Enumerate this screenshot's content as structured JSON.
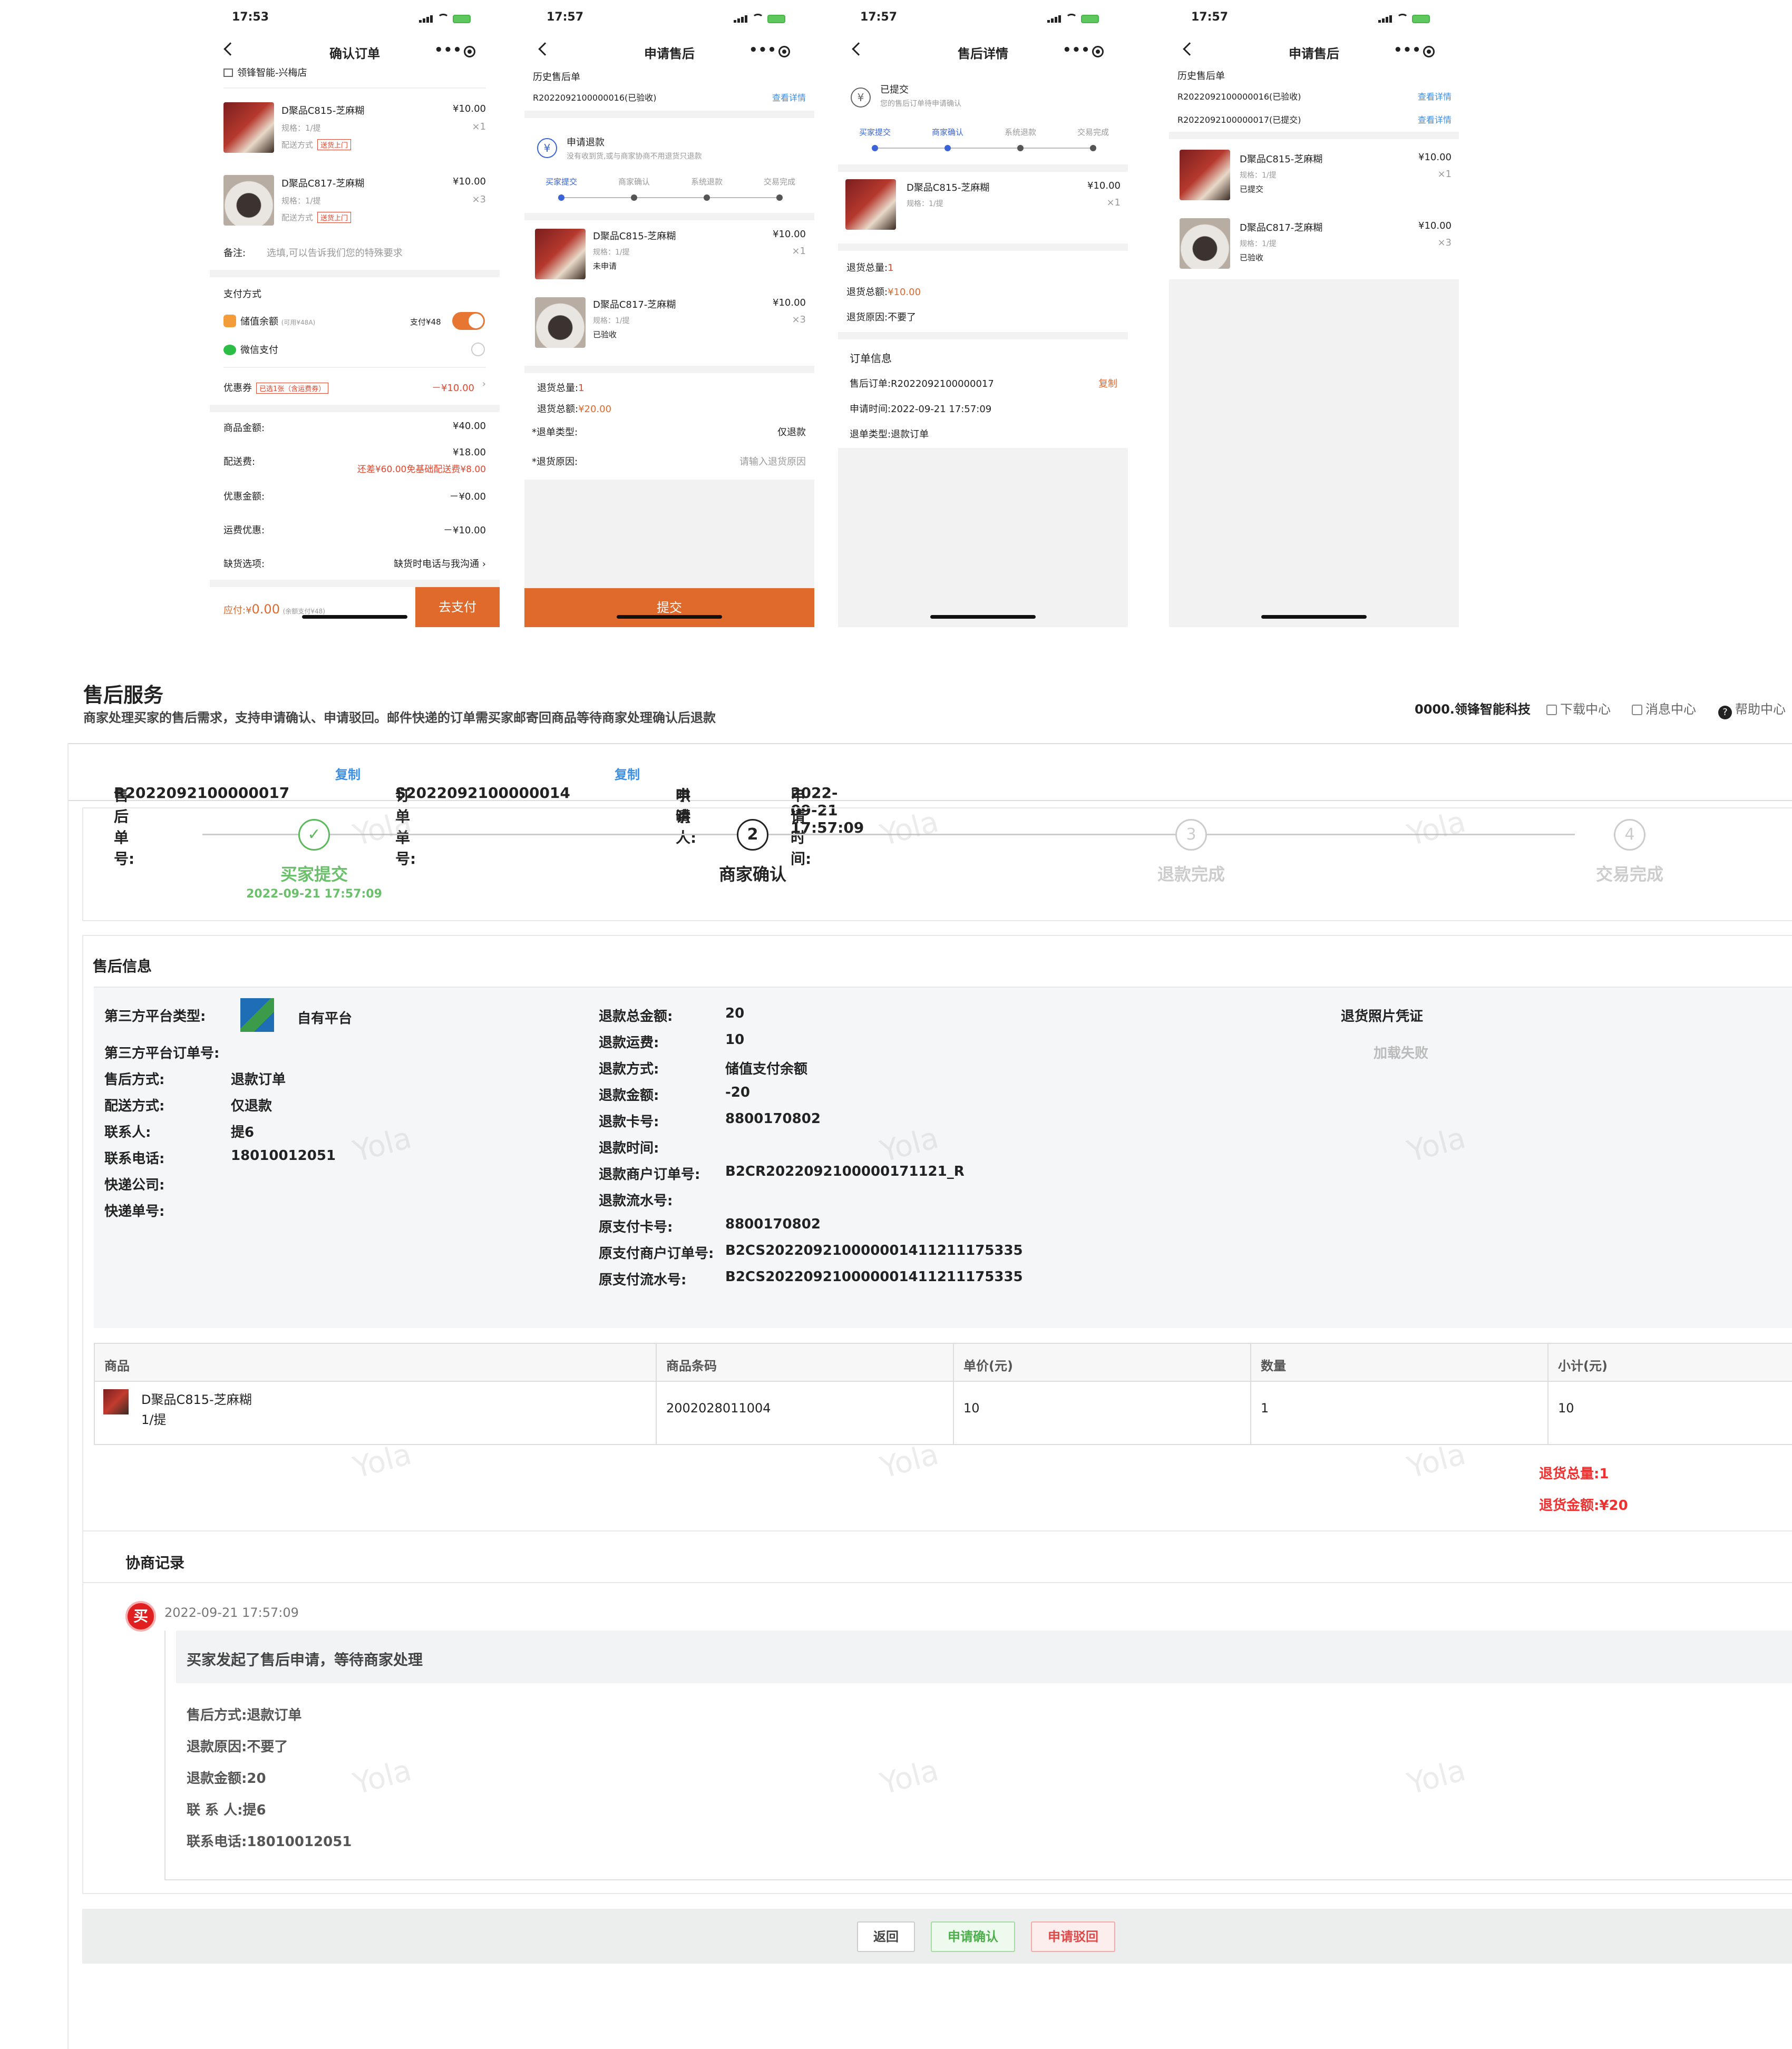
{
  "status_time_1": "17:53",
  "status_time_2": "17:57",
  "phone1": {
    "title": "确认订单",
    "store": "领锋智能-兴梅店",
    "items": [
      {
        "name": "D聚品C815-芝麻糊",
        "spec": "规格：1/提",
        "ship_label": "配送方式",
        "ship_tag": "送货上门",
        "price": "¥10.00",
        "qty": "×1"
      },
      {
        "name": "D聚品C817-芝麻糊",
        "spec": "规格：1/提",
        "ship_label": "配送方式",
        "ship_tag": "送货上门",
        "price": "¥10.00",
        "qty": "×3"
      }
    ],
    "remark_label": "备注:",
    "remark_placeholder": "选填,可以告诉我们您的特殊要求",
    "pay_method_title": "支付方式",
    "pay_balance": "储值余额",
    "pay_balance_avail": "(可用¥48A)",
    "pay_balance_amount": "支付¥48",
    "pay_wechat": "微信支付",
    "coupon_label": "优惠券",
    "coupon_tag": "已选1张（含运费券）",
    "coupon_amount": "－¥10.00",
    "goods_amount_label": "商品金额:",
    "goods_amount": "¥40.00",
    "delivery_label": "配送费:",
    "delivery_amount": "¥18.00",
    "delivery_note": "还差¥60.00免基础配送费¥8.00",
    "discount_label": "优惠金额:",
    "discount_amount": "－¥0.00",
    "freight_discount_label": "运费优惠:",
    "freight_discount_amount": "－¥10.00",
    "shortage_label": "缺货选项:",
    "shortage_value": "缺货时电话与我沟通",
    "payable_label": "应付:¥",
    "payable_amount": "0.00",
    "payable_note": "(余额支付¥48)",
    "pay_button": "去支付"
  },
  "phone2": {
    "title": "申请售后",
    "history_title": "历史售后单",
    "history_no": "R2022092100000016(已验收)",
    "history_link": "查看详情",
    "refund_title": "申请退款",
    "refund_sub": "没有收到货,或与商家协商不用退货只退款",
    "steps": [
      "买家提交",
      "商家确认",
      "系统退款",
      "交易完成"
    ],
    "items": [
      {
        "name": "D聚品C815-芝麻糊",
        "spec": "规格：1/提",
        "status": "未申请",
        "price": "¥10.00",
        "qty": "×1"
      },
      {
        "name": "D聚品C817-芝麻糊",
        "spec": "规格：1/提",
        "status": "已验收",
        "price": "¥10.00",
        "qty": "×3"
      }
    ],
    "total_qty_label": "退货总量:",
    "total_qty": "1",
    "total_amount_label": "退货总额:",
    "total_amount": "¥20.00",
    "type_label": "*退单类型:",
    "type_value": "仅退款",
    "reason_label": "*退货原因:",
    "reason_placeholder": "请输入退货原因",
    "submit": "提交"
  },
  "phone3": {
    "title": "售后详情",
    "status": "已提交",
    "status_sub": "您的售后订单待申请确认",
    "steps": [
      "买家提交",
      "商家确认",
      "系统退款",
      "交易完成"
    ],
    "item": {
      "name": "D聚品C815-芝麻糊",
      "spec": "规格：1/提",
      "price": "¥10.00",
      "qty": "×1"
    },
    "total_qty_label": "退货总量:",
    "total_qty": "1",
    "total_amount_label": "退货总额:",
    "total_amount": "¥10.00",
    "reason_label": "退货原因:",
    "reason": "不要了",
    "order_info_title": "订单信息",
    "order_no_label": "售后订单:",
    "order_no": "R2022092100000017",
    "copy": "复制",
    "apply_time_label": "申请时间:",
    "apply_time": "2022-09-21 17:57:09",
    "refund_type_label": "退单类型:",
    "refund_type": "退款订单"
  },
  "phone4": {
    "title": "申请售后",
    "history_title": "历史售后单",
    "history": [
      {
        "no": "R2022092100000016(已验收)",
        "link": "查看详情"
      },
      {
        "no": "R2022092100000017(已提交)",
        "link": "查看详情"
      }
    ],
    "items": [
      {
        "name": "D聚品C815-芝麻糊",
        "spec": "规格：1/提",
        "status": "已提交",
        "price": "¥10.00",
        "qty": "×1"
      },
      {
        "name": "D聚品C817-芝麻糊",
        "spec": "规格：1/提",
        "status": "已验收",
        "price": "¥10.00",
        "qty": "×3"
      }
    ]
  },
  "web": {
    "title": "售后服务",
    "subtitle": "商家处理买家的售后需求，支持申请确认、申请驳回。邮件快递的订单需买家邮寄回商品等待商家处理确认后退款",
    "company": "0000.领锋智能科技",
    "download": "下载中心",
    "messages": "消息中心",
    "help": "帮助中心",
    "after_no_label": "售后单号:",
    "after_no": "R2022092100000017",
    "order_no_label": "订单单号:",
    "order_no": "S2022092100000014",
    "copy": "复制",
    "applicant_label": "申请人:",
    "applicant": "哄哄",
    "apply_time_label": "申请时间:",
    "apply_time": "2022-09-21 17:57:09",
    "steps": [
      {
        "num": "✓",
        "label": "买家提交",
        "date": "2022-09-21 17:57:09"
      },
      {
        "num": "2",
        "label": "商家确认",
        "date": ""
      },
      {
        "num": "3",
        "label": "退款完成",
        "date": ""
      },
      {
        "num": "4",
        "label": "交易完成",
        "date": ""
      }
    ],
    "section_title": "售后信息",
    "left": [
      {
        "k": "第三方平台类型:",
        "v": "自有平台"
      },
      {
        "k": "第三方平台订单号:",
        "v": ""
      },
      {
        "k": "售后方式:",
        "v": "退款订单"
      },
      {
        "k": "配送方式:",
        "v": "仅退款"
      },
      {
        "k": "联系人:",
        "v": "提6"
      },
      {
        "k": "联系电话:",
        "v": "18010012051"
      },
      {
        "k": "快递公司:",
        "v": ""
      },
      {
        "k": "快递单号:",
        "v": ""
      }
    ],
    "mid": [
      {
        "k": "退款总金额:",
        "v": "20"
      },
      {
        "k": "退款运费:",
        "v": "10"
      },
      {
        "k": "退款方式:",
        "v": "储值支付余额"
      },
      {
        "k": "退款金额:",
        "v": "-20"
      },
      {
        "k": "退款卡号:",
        "v": "8800170802"
      },
      {
        "k": "退款时间:",
        "v": ""
      },
      {
        "k": "退款商户订单号:",
        "v": "B2CR2022092100000171121_R"
      },
      {
        "k": "退款流水号:",
        "v": ""
      },
      {
        "k": "原支付卡号:",
        "v": "8800170802"
      },
      {
        "k": "原支付商户订单号:",
        "v": "B2CS20220921000000141121​1175335"
      },
      {
        "k": "原支付流水号:",
        "v": "B2CS20220921000000141121​1175335"
      }
    ],
    "photo_title": "退货照片凭证",
    "photo_fail": "加载失败",
    "table": {
      "headers": [
        "商品",
        "商品条码",
        "单价(元)",
        "数量",
        "小计(元)"
      ],
      "row": {
        "name": "D聚品C815-芝麻糊",
        "spec": "1/提",
        "barcode": "2002028011004",
        "price": "10",
        "qty": "1",
        "subtotal": "10"
      }
    },
    "total_qty": "退货总量:1",
    "total_amount": "退货金额:¥20",
    "record_title": "协商记录",
    "record_avatar": "买",
    "record_date": "2022-09-21 17:57:09",
    "record_msg": "买家发起了售后申请，等待商家处理",
    "record_lines": [
      "售后方式:退款订单",
      "退款原因:不要了",
      "退款金额:20",
      "联 系 人:提6",
      "联系电话:18010012051"
    ],
    "btn_back": "返回",
    "btn_confirm": "申请确认",
    "btn_reject": "申请驳回",
    "watermark": "Yola"
  }
}
